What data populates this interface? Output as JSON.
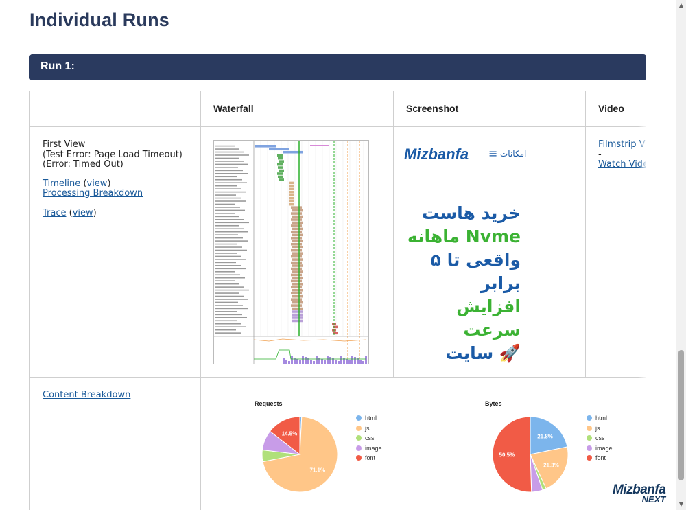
{
  "page": {
    "title": "Individual Runs"
  },
  "run": {
    "header": "Run 1:"
  },
  "table": {
    "headers": {
      "waterfall": "Waterfall",
      "screenshot": "Screenshot",
      "video": "Video"
    },
    "first_view": {
      "label": "First View",
      "error": "(Test Error: Page Load Timeout)",
      "error2": "(Error: Timed Out)",
      "timeline": "Timeline",
      "timeline_view": "view",
      "processing": "Processing Breakdown",
      "trace": "Trace",
      "trace_view": "view"
    },
    "video": {
      "filmstrip": "Filmstrip View",
      "dash": "-",
      "watch": "Watch Video"
    },
    "content_breakdown": "Content Breakdown"
  },
  "screenshot": {
    "brand": "Mizbanfa",
    "menu": "امکانات",
    "lines": [
      "خرید هاست",
      "ماهانه Nvme",
      "واقعی تا ۵ برابر",
      "افزایش سرعت",
      "سایت 🚀"
    ],
    "colors": {
      "blue": "#1a5aa6",
      "green": "#3bb233"
    }
  },
  "chart_data": [
    {
      "type": "pie",
      "title": "Requests",
      "labels": [
        "html",
        "js",
        "css",
        "image",
        "font"
      ],
      "values": [
        0.8,
        71.1,
        5.0,
        8.6,
        14.5
      ],
      "data_labels": [
        "",
        "71.1%",
        "",
        "",
        "14.5%"
      ],
      "colors": [
        "#7cb5ec",
        "#ffc688",
        "#b0e07a",
        "#c89ce8",
        "#f15b46"
      ],
      "legend": "right"
    },
    {
      "type": "pie",
      "title": "Bytes",
      "labels": [
        "html",
        "js",
        "css",
        "image",
        "font"
      ],
      "values": [
        21.8,
        21.3,
        1.6,
        4.8,
        50.5
      ],
      "data_labels": [
        "21.8%",
        "21.3%",
        "",
        "",
        "50.5%"
      ],
      "colors": [
        "#7cb5ec",
        "#ffc688",
        "#b0e07a",
        "#c89ce8",
        "#f15b46"
      ],
      "legend": "right"
    }
  ],
  "watermark": {
    "line1": "Mizbanfa",
    "line2": "NEXT"
  }
}
